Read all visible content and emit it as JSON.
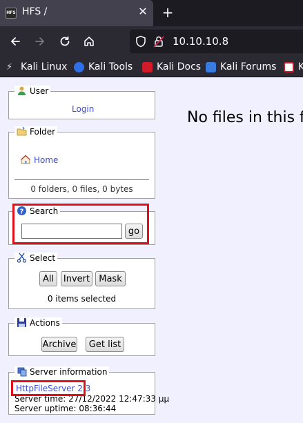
{
  "browser": {
    "tab_title": "HFS /",
    "favicon_text": "HFS",
    "url": "10.10.10.8",
    "new_tab_label": "+",
    "bookmarks": [
      {
        "label": "Kali Linux"
      },
      {
        "label": "Kali Tools"
      },
      {
        "label": "Kali Docs"
      },
      {
        "label": "Kali Forums"
      },
      {
        "label": "K"
      }
    ]
  },
  "page": {
    "user_panel": {
      "legend": "User",
      "login_link": "Login"
    },
    "folder_panel": {
      "legend": "Folder",
      "home_link": "Home",
      "summary": "0 folders, 0 files, 0 bytes"
    },
    "search_panel": {
      "legend": "Search",
      "input_value": "",
      "go_label": "go"
    },
    "select_panel": {
      "legend": "Select",
      "all_label": "All",
      "invert_label": "Invert",
      "mask_label": "Mask",
      "status": "0 items selected"
    },
    "actions_panel": {
      "legend": "Actions",
      "archive_label": "Archive",
      "getlist_label": "Get list"
    },
    "server_panel": {
      "legend": "Server information",
      "version_link": "HttpFileServer 2.3",
      "server_time": "Server time: 27/12/2022 12:47:33 μμ",
      "server_uptime": "Server uptime: 08:36:44"
    },
    "no_files_message": "No files in this fo"
  }
}
